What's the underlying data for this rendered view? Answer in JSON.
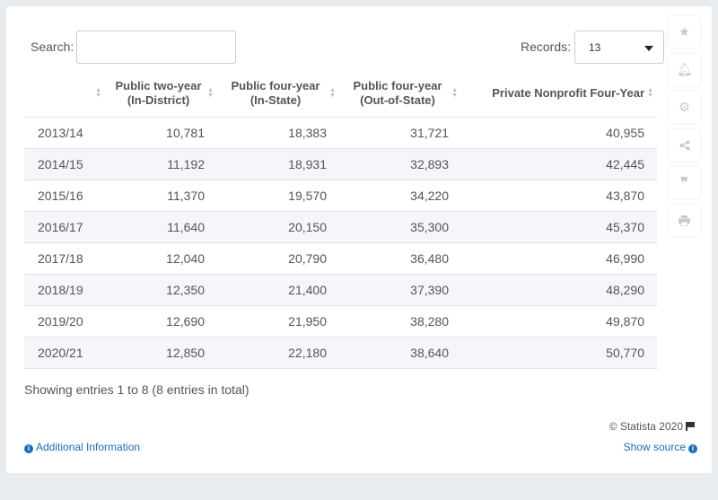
{
  "search": {
    "label": "Search:",
    "value": ""
  },
  "records": {
    "label": "Records:",
    "value": "13"
  },
  "table": {
    "headers": [
      "",
      "Public two-year\n(In-District)",
      "Public four-year\n(In-State)",
      "Public four-year\n(Out-of-State)",
      "Private Nonprofit Four-Year"
    ],
    "rows": [
      [
        "2013/14",
        "10,781",
        "18,383",
        "31,721",
        "40,955"
      ],
      [
        "2014/15",
        "11,192",
        "18,931",
        "32,893",
        "42,445"
      ],
      [
        "2015/16",
        "11,370",
        "19,570",
        "34,220",
        "43,870"
      ],
      [
        "2016/17",
        "11,640",
        "20,150",
        "35,300",
        "45,370"
      ],
      [
        "2017/18",
        "12,040",
        "20,790",
        "36,480",
        "46,990"
      ],
      [
        "2018/19",
        "12,350",
        "21,400",
        "37,390",
        "48,290"
      ],
      [
        "2019/20",
        "12,690",
        "21,950",
        "38,280",
        "49,870"
      ],
      [
        "2020/21",
        "12,850",
        "22,180",
        "38,640",
        "50,770"
      ]
    ]
  },
  "footer": {
    "entries_info": "Showing entries 1 to 8 (8 entries in total)",
    "copyright": "© Statista 2020",
    "additional_info": "Additional Information",
    "show_source": "Show source"
  },
  "sidebar_icons": [
    "star-icon",
    "bell-icon",
    "gear-icon",
    "share-icon",
    "quote-icon",
    "print-icon"
  ]
}
